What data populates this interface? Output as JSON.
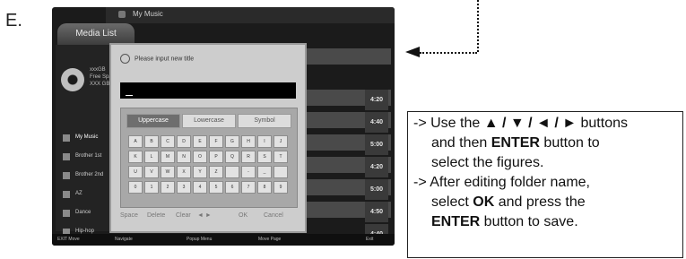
{
  "step_letter": "E.",
  "screen": {
    "title": "My Music",
    "media_list_tab": "Media List",
    "usage": [
      "xxxGB",
      "Free Space",
      "XXX GB"
    ],
    "side_items": [
      {
        "label": "My Music",
        "selected": true
      },
      {
        "label": "Brother 1st",
        "selected": false
      },
      {
        "label": "Brother 2nd",
        "selected": false
      },
      {
        "label": "AZ",
        "selected": false
      },
      {
        "label": "Dance",
        "selected": false
      },
      {
        "label": "Hip-hop",
        "selected": false
      }
    ],
    "times": [
      "4:20",
      "4:40",
      "5:00",
      "4:20",
      "5:00",
      "4:50",
      "4:40"
    ],
    "bottom_bar": [
      "EXIT Move",
      "Navigate",
      "Popup Menu",
      "Move Page",
      "Exit"
    ]
  },
  "dialog": {
    "title": "Please input new title",
    "tabs": [
      "Uppercase",
      "Lowercase",
      "Symbol"
    ],
    "keys": [
      [
        "A",
        "B",
        "C",
        "D",
        "E",
        "F",
        "G",
        "H",
        "I",
        "J"
      ],
      [
        "K",
        "L",
        "M",
        "N",
        "O",
        "P",
        "Q",
        "R",
        "S",
        "T"
      ],
      [
        "U",
        "V",
        "W",
        "X",
        "Y",
        "Z",
        "",
        "-",
        "_",
        ""
      ],
      [
        "0",
        "1",
        "2",
        "3",
        "4",
        "5",
        "6",
        "7",
        "8",
        "9"
      ]
    ],
    "actions": [
      "Space",
      "Delete",
      "Clear",
      "◄ ►",
      "OK",
      "Cancel"
    ]
  },
  "instructions": {
    "line1_prefix": "-> Use the ",
    "line1_arrows": "▲ / ▼ / ◄ / ►",
    "line1_suffix": " buttons",
    "line2_prefix": "and then ",
    "line2_bold": "ENTER",
    "line2_suffix": " button to",
    "line3": "select the figures.",
    "line4": "-> After editing folder name,",
    "line5_prefix": "select ",
    "line5_bold": "OK",
    "line5_suffix": " and press the",
    "line6_bold": "ENTER",
    "line6_suffix": " button to save."
  }
}
